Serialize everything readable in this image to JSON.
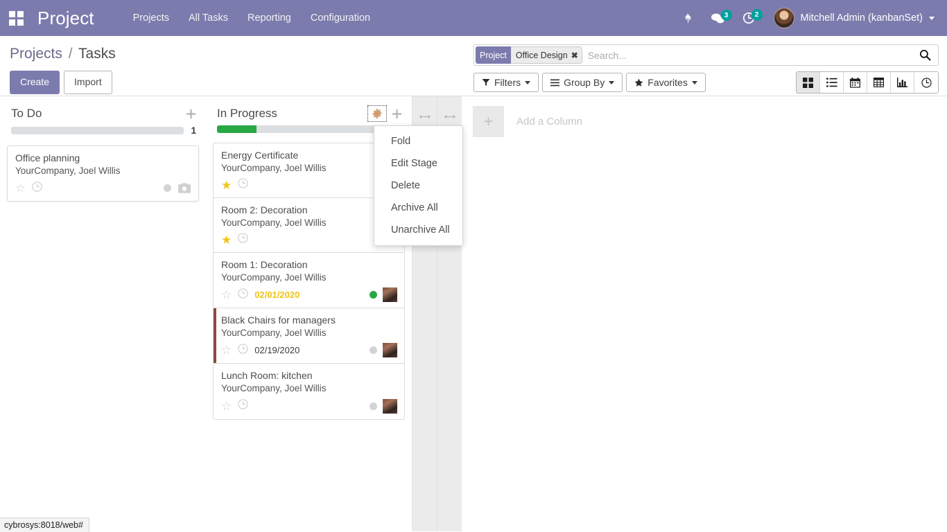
{
  "navbar": {
    "apps_icon": "apps-grid-icon",
    "brand": "Project",
    "links": [
      {
        "label": "Projects"
      },
      {
        "label": "All Tasks"
      },
      {
        "label": "Reporting"
      },
      {
        "label": "Configuration"
      }
    ],
    "bug_icon": "bug-icon",
    "messages": {
      "icon": "chat-bubble-icon",
      "count": "3"
    },
    "activities": {
      "icon": "clock-activity-icon",
      "count": "2"
    },
    "user": {
      "name": "Mitchell Admin (kanbanSet)",
      "avatar": "user-avatar"
    },
    "accent_color": "#7C7BAD",
    "badge_color": "#00A09D"
  },
  "control_panel": {
    "breadcrumb": {
      "parent": "Projects",
      "separator": "/",
      "current": "Tasks"
    },
    "create_label": "Create",
    "import_label": "Import",
    "search": {
      "facet_label": "Project",
      "facet_value": "Office Design",
      "facet_remove": "✖",
      "placeholder": "Search...",
      "value": ""
    },
    "tools": [
      {
        "label": "Filters",
        "icon": "filter-icon"
      },
      {
        "label": "Group By",
        "icon": "list-lines-icon"
      },
      {
        "label": "Favorites",
        "icon": "star-icon"
      }
    ],
    "views": [
      {
        "name": "kanban",
        "active": true
      },
      {
        "name": "list",
        "active": false
      },
      {
        "name": "calendar",
        "active": false
      },
      {
        "name": "pivot",
        "active": false
      },
      {
        "name": "graph",
        "active": false
      },
      {
        "name": "activity",
        "active": false
      }
    ]
  },
  "kanban": {
    "columns": [
      {
        "title": "To Do",
        "count": "1",
        "progress_percent": 0,
        "has_gear": false,
        "cards": [
          {
            "title": "Office planning",
            "subtitle": "YourCompany, Joel Willis",
            "starred": false,
            "date": "",
            "date_warn": false,
            "dot": "gray",
            "avatar": "placeholder",
            "stripe": false
          }
        ]
      },
      {
        "title": "In Progress",
        "count": "",
        "progress_percent": 22,
        "has_gear": true,
        "cards": [
          {
            "title": "Energy Certificate",
            "subtitle": "YourCompany, Joel Willis",
            "starred": true,
            "date": "",
            "date_warn": false,
            "dot": "gray",
            "avatar": "none",
            "stripe": false
          },
          {
            "title": "Room 2: Decoration",
            "subtitle": "YourCompany, Joel Willis",
            "starred": true,
            "date": "",
            "date_warn": false,
            "dot": "gray",
            "avatar": "none",
            "stripe": false
          },
          {
            "title": "Room 1: Decoration",
            "subtitle": "YourCompany, Joel Willis",
            "starred": false,
            "date": "02/01/2020",
            "date_warn": true,
            "dot": "green",
            "avatar": "photo",
            "stripe": false
          },
          {
            "title": "Black Chairs for managers",
            "subtitle": "YourCompany, Joel Willis",
            "starred": false,
            "date": "02/19/2020",
            "date_warn": false,
            "dot": "gray",
            "avatar": "photo",
            "stripe": true
          },
          {
            "title": "Lunch Room: kitchen",
            "subtitle": "YourCompany, Joel Willis",
            "starred": false,
            "date": "",
            "date_warn": false,
            "dot": "gray",
            "avatar": "photo",
            "stripe": false
          }
        ]
      }
    ],
    "add_column": {
      "plus": "+",
      "label": "Add a Column"
    },
    "progress_color": "#28a745",
    "stripe_color": "#8b4a46"
  },
  "stage_dropdown": {
    "items": [
      {
        "label": "Fold"
      },
      {
        "label": "Edit Stage"
      },
      {
        "label": "Delete"
      },
      {
        "label": "Archive All"
      },
      {
        "label": "Unarchive All"
      }
    ]
  },
  "statusbar": {
    "text": "cybrosys:8018/web#"
  }
}
